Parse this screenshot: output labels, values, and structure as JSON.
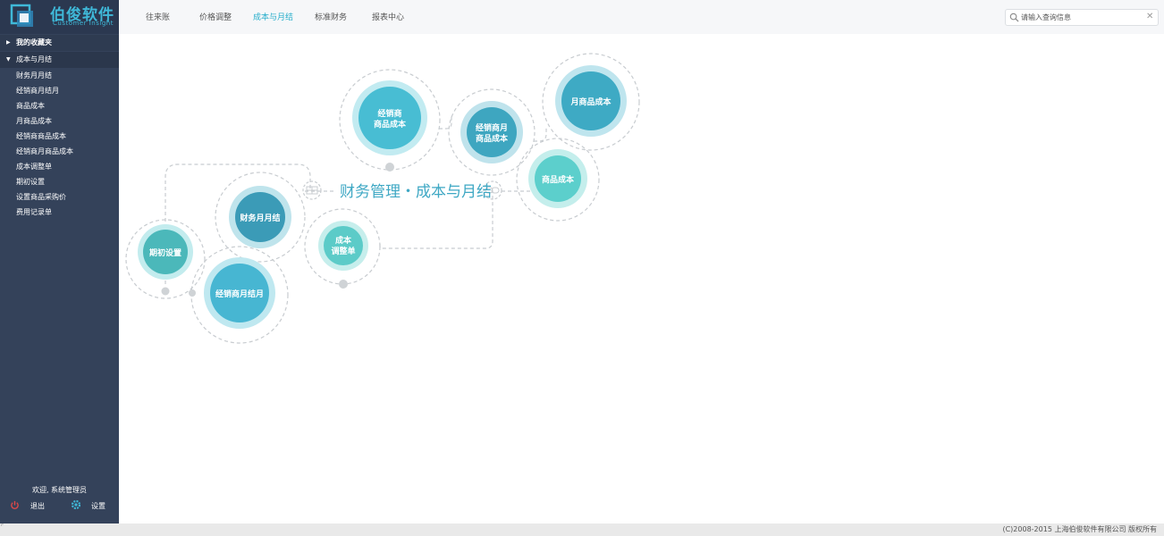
{
  "logo": {
    "name": "伯俊软件",
    "sub": "Customer Insight"
  },
  "sidebar": {
    "favorites_label": "我的收藏夹",
    "cost_section_label": "成本与月结",
    "items": [
      {
        "label": "财务月月结"
      },
      {
        "label": "经销商月结月"
      },
      {
        "label": "商品成本"
      },
      {
        "label": "月商品成本"
      },
      {
        "label": "经销商商品成本"
      },
      {
        "label": "经销商月商品成本"
      },
      {
        "label": "成本调整单"
      },
      {
        "label": "期初设置"
      },
      {
        "label": "设置商品采购价"
      },
      {
        "label": "费用记录单"
      }
    ],
    "welcome": "欢迎, 系统管理员",
    "logout_label": "退出",
    "settings_label": "设置"
  },
  "nav": {
    "items": [
      {
        "label": "往来账"
      },
      {
        "label": "价格调整"
      },
      {
        "label": "成本与月结"
      },
      {
        "label": "标准财务"
      },
      {
        "label": "报表中心"
      }
    ],
    "active_index": 2
  },
  "search": {
    "placeholder": "请输入查询信息",
    "value": ""
  },
  "diagram": {
    "title": "财务管理・成本与月结",
    "bubbles": {
      "qichu": "期初设置",
      "caiwu": "财务月月结",
      "jxsyj": "经销商月结月",
      "tiaozheng": [
        "成本",
        "调整单"
      ],
      "jxs_cost": [
        "经销商",
        "商品成本"
      ],
      "jxsy_cost": [
        "经销商月",
        "商品成本"
      ],
      "month_cost": "月商品成本",
      "goods_cost": "商品成本"
    }
  },
  "footer": {
    "copyright": "(C)2008-2015 上海伯俊软件有限公司 版权所有"
  },
  "colors": {
    "accent": "#27aecb",
    "sidebar": "#34425a",
    "bubble_dark": "#3a9fb8",
    "bubble_mid": "#45b8d4",
    "bubble_light": "#5ccfd8"
  }
}
